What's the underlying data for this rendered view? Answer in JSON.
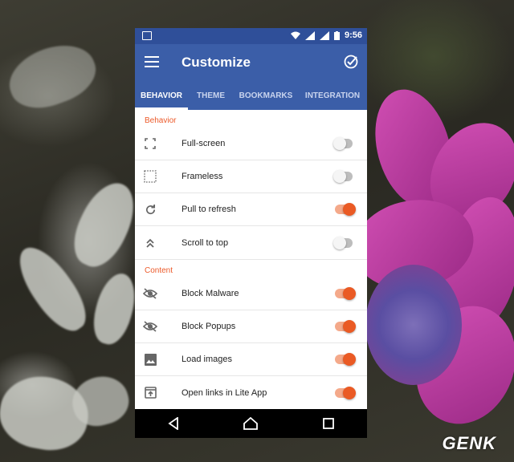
{
  "status_bar": {
    "time": "9:56"
  },
  "app_bar": {
    "title": "Customize"
  },
  "tabs": [
    {
      "label": "BEHAVIOR",
      "active": true
    },
    {
      "label": "THEME",
      "active": false
    },
    {
      "label": "BOOKMARKS",
      "active": false
    },
    {
      "label": "INTEGRATION",
      "active": false
    }
  ],
  "sections": {
    "behavior": {
      "header": "Behavior",
      "items": [
        {
          "label": "Full-screen",
          "icon": "fullscreen-icon",
          "enabled": false
        },
        {
          "label": "Frameless",
          "icon": "frameless-icon",
          "enabled": false
        },
        {
          "label": "Pull to refresh",
          "icon": "refresh-icon",
          "enabled": true
        },
        {
          "label": "Scroll to top",
          "icon": "double-chevron-up-icon",
          "enabled": false
        }
      ]
    },
    "content": {
      "header": "Content",
      "items": [
        {
          "label": "Block Malware",
          "icon": "eye-off-icon",
          "enabled": true
        },
        {
          "label": "Block Popups",
          "icon": "eye-off-icon",
          "enabled": true
        },
        {
          "label": "Load images",
          "icon": "image-icon",
          "enabled": true
        },
        {
          "label": "Open links in Lite App",
          "icon": "open-in-app-icon",
          "enabled": true
        }
      ]
    }
  },
  "colors": {
    "primary": "#3b5ea8",
    "status_bar": "#2f4f99",
    "accent": "#ea5a24",
    "section_header": "#ec5a2a"
  },
  "watermark": "GENK"
}
